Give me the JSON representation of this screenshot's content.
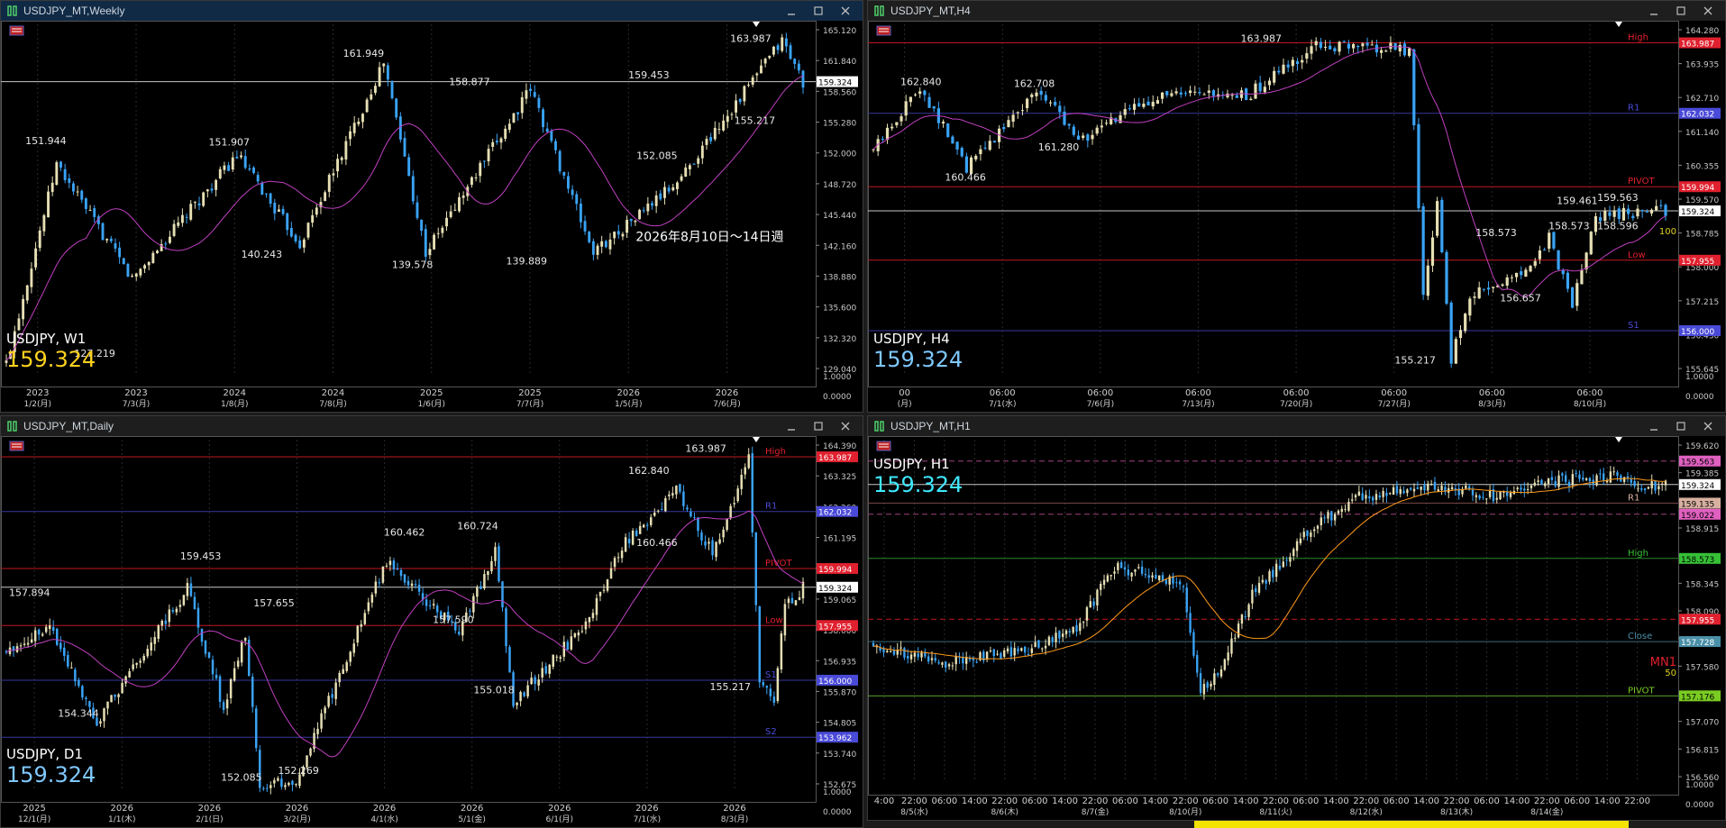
{
  "colors": {
    "bull": "#e6dfb4",
    "bear": "#3aa3f5",
    "grid": "#2a2a2a"
  },
  "windows": [
    {
      "id": "weekly",
      "title": "USDJPY_MT,Weekly",
      "active": true,
      "symbol": "USDJPY, W1",
      "price": "159.324",
      "price_color": "#ffd21e",
      "annotation": "2026年8月10日～14日週",
      "y_min": 126.3,
      "y_max": 165.8,
      "y_ticks": [
        "165.120",
        "161.840",
        "158.560",
        "155.280",
        "152.000",
        "148.720",
        "145.440",
        "142.160",
        "138.880",
        "135.600",
        "132.320",
        "129.040"
      ],
      "sub_ticks": [
        "1.0000",
        "0.0000"
      ],
      "x_ticks": [
        {
          "t": "2023",
          "d": "1/2(月)"
        },
        {
          "t": "2023",
          "d": "7/3(月)"
        },
        {
          "t": "2024",
          "d": "1/8(月)"
        },
        {
          "t": "2024",
          "d": "7/8(月)"
        },
        {
          "t": "2025",
          "d": "1/6(月)"
        },
        {
          "t": "2025",
          "d": "7/7(月)"
        },
        {
          "t": "2026",
          "d": "1/5(月)"
        },
        {
          "t": "2026",
          "d": "7/6(月)"
        }
      ],
      "labels": [
        "151.944",
        "127.219",
        "151.907",
        "140.243",
        "161.949",
        "139.578",
        "158.877",
        "139.889",
        "159.453",
        "152.085",
        "163.987",
        "155.217"
      ],
      "levels": [
        {
          "tag": "159.324",
          "price": 159.324,
          "color": "#c8c8c8",
          "box": "#ffffff",
          "boxtext": "#000"
        }
      ],
      "series": {
        "n": 190,
        "pts": [
          [
            0,
            127.5
          ],
          [
            12,
            150
          ],
          [
            30,
            137
          ],
          [
            55,
            151
          ],
          [
            70,
            141
          ],
          [
            90,
            161.5
          ],
          [
            100,
            140
          ],
          [
            125,
            158.5
          ],
          [
            140,
            140
          ],
          [
            160,
            148
          ],
          [
            185,
            164
          ],
          [
            190,
            159.3
          ]
        ]
      }
    },
    {
      "id": "h4",
      "title": "USDJPY_MT,H4",
      "active": false,
      "symbol": "USDJPY, H4",
      "price": "159.324",
      "price_color": "#7fc8ff",
      "annotation": "",
      "y_min": 154.8,
      "y_max": 164.5,
      "y_ticks": [
        "164.280",
        "163.935",
        "162.710",
        "161.140",
        "160.355",
        "159.570",
        "158.785",
        "158.000",
        "157.215",
        "156.430",
        "155.645"
      ],
      "sub_ticks": [
        "1.0000",
        "0.0000"
      ],
      "x_ticks": [
        {
          "t": "00",
          "d": "(月)"
        },
        {
          "t": "06:00",
          "d": "7/1(水)"
        },
        {
          "t": "06:00",
          "d": "7/6(月)"
        },
        {
          "t": "06:00",
          "d": "7/13(月)"
        },
        {
          "t": "06:00",
          "d": "7/20(月)"
        },
        {
          "t": "06:00",
          "d": "7/27(月)"
        },
        {
          "t": "06:00",
          "d": "8/3(月)"
        },
        {
          "t": "06:00",
          "d": "8/10(月)"
        }
      ],
      "labels": [
        "162.840",
        "160.466",
        "162.708",
        "161.280",
        "163.987",
        "158.573",
        "159.461",
        "159.563",
        "158.573",
        "158.596",
        "156.657",
        "155.217"
      ],
      "levels": [
        {
          "tag": "163.987",
          "price": 163.987,
          "color": "#c01820",
          "box": "#e0202e",
          "boxtext": "#fff",
          "name": "High"
        },
        {
          "tag": "162.032",
          "price": 162.032,
          "color": "#3838a0",
          "box": "#4a4ad8",
          "boxtext": "#fff",
          "name": "R1"
        },
        {
          "tag": "159.994",
          "price": 159.994,
          "color": "#c01820",
          "box": "#e0202e",
          "boxtext": "#fff",
          "name": "PIVOT"
        },
        {
          "tag": "159.324",
          "price": 159.324,
          "color": "#c8c8c8",
          "box": "#ffffff",
          "boxtext": "#000"
        },
        {
          "tag": "157.955",
          "price": 157.955,
          "color": "#c01820",
          "box": "#e0202e",
          "boxtext": "#fff",
          "name": "Low"
        },
        {
          "tag": "156.000",
          "price": 156.0,
          "color": "#3838a0",
          "box": "#4a4ad8",
          "boxtext": "#fff",
          "name": "S1"
        }
      ],
      "side_mark": "100",
      "series": {
        "n": 170,
        "pts": [
          [
            0,
            161
          ],
          [
            10,
            162.8
          ],
          [
            20,
            160.5
          ],
          [
            35,
            162.7
          ],
          [
            45,
            161.3
          ],
          [
            60,
            162.5
          ],
          [
            80,
            162.5
          ],
          [
            95,
            163.9
          ],
          [
            115,
            163.8
          ],
          [
            118,
            157
          ],
          [
            121,
            159.5
          ],
          [
            124,
            155.2
          ],
          [
            128,
            157
          ],
          [
            140,
            157.6
          ],
          [
            145,
            158.6
          ],
          [
            150,
            156.7
          ],
          [
            155,
            159.2
          ],
          [
            168,
            159.3
          ],
          [
            170,
            159.3
          ]
        ]
      }
    },
    {
      "id": "daily",
      "title": "USDJPY_MT,Daily",
      "active": false,
      "symbol": "USDJPY, D1",
      "price": "159.324",
      "price_color": "#7fc8ff",
      "annotation": "",
      "y_min": 152.1,
      "y_max": 164.6,
      "y_ticks": [
        "164.390",
        "163.325",
        "162.260",
        "161.195",
        "160.130",
        "159.065",
        "158.000",
        "156.935",
        "155.870",
        "154.805",
        "153.740",
        "152.675"
      ],
      "sub_ticks": [
        "1.0000",
        "0.0000"
      ],
      "x_ticks": [
        {
          "t": "2025",
          "d": "12/1(月)"
        },
        {
          "t": "2026",
          "d": "1/1(木)"
        },
        {
          "t": "2026",
          "d": "2/1(日)"
        },
        {
          "t": "2026",
          "d": "3/2(月)"
        },
        {
          "t": "2026",
          "d": "4/1(水)"
        },
        {
          "t": "2026",
          "d": "5/1(金)"
        },
        {
          "t": "2026",
          "d": "6/1(月)"
        },
        {
          "t": "2026",
          "d": "7/1(水)"
        },
        {
          "t": "2026",
          "d": "8/3(月)"
        }
      ],
      "labels": [
        "157.894",
        "154.344",
        "159.453",
        "157.655",
        "152.085",
        "152.269",
        "160.462",
        "157.590",
        "160.724",
        "155.018",
        "162.840",
        "160.466",
        "163.987",
        "155.217"
      ],
      "levels": [
        {
          "tag": "163.987",
          "price": 163.987,
          "color": "#c01820",
          "box": "#e0202e",
          "boxtext": "#fff",
          "name": "High"
        },
        {
          "tag": "162.032",
          "price": 162.032,
          "color": "#3838a0",
          "box": "#4a4ad8",
          "boxtext": "#fff",
          "name": "R1"
        },
        {
          "tag": "159.994",
          "price": 159.994,
          "color": "#c01820",
          "box": "#e0202e",
          "boxtext": "#fff",
          "name": "PIVOT"
        },
        {
          "tag": "159.324",
          "price": 159.324,
          "color": "#c8c8c8",
          "box": "#ffffff",
          "boxtext": "#000"
        },
        {
          "tag": "157.955",
          "price": 157.955,
          "color": "#c01820",
          "box": "#e0202e",
          "boxtext": "#fff",
          "name": "Low"
        },
        {
          "tag": "156.000",
          "price": 156.0,
          "color": "#3838a0",
          "box": "#4a4ad8",
          "boxtext": "#fff",
          "name": "S1"
        },
        {
          "tag": "153.962",
          "price": 153.962,
          "color": "#3838a0",
          "box": "#4a4ad8",
          "boxtext": "#fff",
          "name": "S2"
        }
      ],
      "series": {
        "n": 220,
        "pts": [
          [
            0,
            157
          ],
          [
            12,
            158
          ],
          [
            25,
            154.5
          ],
          [
            50,
            159.3
          ],
          [
            60,
            155
          ],
          [
            66,
            157.6
          ],
          [
            70,
            152.2
          ],
          [
            80,
            152.4
          ],
          [
            105,
            160.3
          ],
          [
            125,
            157.7
          ],
          [
            135,
            160.6
          ],
          [
            140,
            155.2
          ],
          [
            160,
            158
          ],
          [
            170,
            160.8
          ],
          [
            185,
            162.8
          ],
          [
            195,
            160.5
          ],
          [
            205,
            163.9
          ],
          [
            208,
            156
          ],
          [
            212,
            155.3
          ],
          [
            215,
            158.7
          ],
          [
            220,
            159.3
          ]
        ]
      }
    },
    {
      "id": "h1",
      "title": "USDJPY_MT,H1",
      "active": false,
      "symbol": "USDJPY, H1",
      "price": "159.324",
      "price_color": "#3fe8ff",
      "annotation": "",
      "y_min": 156.3,
      "y_max": 159.78,
      "y_ticks": [
        "159.620",
        "159.385",
        "159.150",
        "158.915",
        "158.580",
        "158.345",
        "158.090",
        "157.835",
        "157.580",
        "157.325",
        "157.070",
        "156.815",
        "156.560"
      ],
      "sub_ticks": [
        "1.0000",
        "0.0000"
      ],
      "x_ticks": [
        {
          "t": "4:00",
          "d": ""
        },
        {
          "t": "22:00",
          "d": "8/5(水)"
        },
        {
          "t": "06:00",
          "d": ""
        },
        {
          "t": "14:00",
          "d": ""
        },
        {
          "t": "22:00",
          "d": "8/6(木)"
        },
        {
          "t": "06:00",
          "d": ""
        },
        {
          "t": "14:00",
          "d": ""
        },
        {
          "t": "22:00",
          "d": "8/7(金)"
        },
        {
          "t": "06:00",
          "d": ""
        },
        {
          "t": "14:00",
          "d": ""
        },
        {
          "t": "22:00",
          "d": "8/10(月)"
        },
        {
          "t": "06:00",
          "d": ""
        },
        {
          "t": "14:00",
          "d": ""
        },
        {
          "t": "22:00",
          "d": "8/11(火)"
        },
        {
          "t": "06:00",
          "d": ""
        },
        {
          "t": "14:00",
          "d": ""
        },
        {
          "t": "22:00",
          "d": "8/12(水)"
        },
        {
          "t": "06:00",
          "d": ""
        },
        {
          "t": "14:00",
          "d": ""
        },
        {
          "t": "22:00",
          "d": "8/13(木)"
        },
        {
          "t": "06:00",
          "d": ""
        },
        {
          "t": "14:00",
          "d": ""
        },
        {
          "t": "22:00",
          "d": "8/14(金)"
        },
        {
          "t": "06:00",
          "d": ""
        },
        {
          "t": "14:00",
          "d": ""
        },
        {
          "t": "22:00",
          "d": ""
        }
      ],
      "labels": [],
      "levels": [
        {
          "tag": "159.563",
          "price": 159.563,
          "color": "#a04080",
          "box": "#e060c0",
          "boxtext": "#000",
          "dash": true
        },
        {
          "tag": "159.324",
          "price": 159.324,
          "color": "#c8c8c8",
          "box": "#ffffff",
          "boxtext": "#000"
        },
        {
          "tag": "159.135",
          "price": 159.135,
          "color": "#7a4a4a",
          "box": "#d8b0a0",
          "boxtext": "#000",
          "name": "R1"
        },
        {
          "tag": "159.022",
          "price": 159.022,
          "color": "#a04080",
          "box": "#e060c0",
          "boxtext": "#000",
          "dash": true
        },
        {
          "tag": "158.573",
          "price": 158.573,
          "color": "#2a8a2a",
          "box": "#36c036",
          "boxtext": "#000",
          "name": "High"
        },
        {
          "tag": "157.955",
          "price": 157.955,
          "color": "#c01820",
          "box": "#e0202e",
          "boxtext": "#fff",
          "dash": true
        },
        {
          "tag": "157.728",
          "price": 157.728,
          "color": "#3a6a7a",
          "box": "#4a90a8",
          "boxtext": "#fff",
          "name": "Close"
        },
        {
          "tag": "157.176",
          "price": 157.176,
          "color": "#5aa02a",
          "box": "#7acc22",
          "boxtext": "#000",
          "name": "PIVOT"
        }
      ],
      "side_mark": "MN1",
      "side_mark2": "50",
      "series": {
        "n": 230,
        "pts": [
          [
            0,
            157.7
          ],
          [
            20,
            157.5
          ],
          [
            45,
            157.65
          ],
          [
            60,
            157.9
          ],
          [
            70,
            158.5
          ],
          [
            80,
            158.4
          ],
          [
            90,
            158.3
          ],
          [
            95,
            157.2
          ],
          [
            100,
            157.4
          ],
          [
            110,
            158.2
          ],
          [
            125,
            158.8
          ],
          [
            140,
            159.2
          ],
          [
            165,
            159.3
          ],
          [
            180,
            159.2
          ],
          [
            195,
            159.35
          ],
          [
            215,
            159.4
          ],
          [
            225,
            159.3
          ],
          [
            230,
            159.32
          ]
        ]
      }
    }
  ]
}
